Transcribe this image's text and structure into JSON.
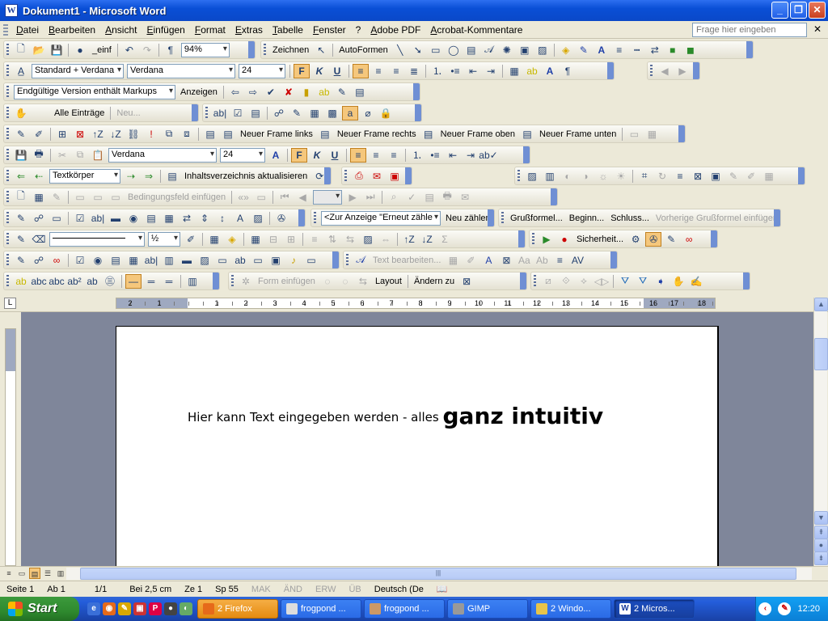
{
  "window": {
    "title": "Dokument1 - Microsoft Word",
    "icon_letter": "W"
  },
  "menu": {
    "items": [
      "Datei",
      "Bearbeiten",
      "Ansicht",
      "Einfügen",
      "Format",
      "Extras",
      "Tabelle",
      "Fenster",
      "?",
      "Adobe PDF",
      "Acrobat-Kommentare"
    ],
    "help_placeholder": "Frage hier eingeben"
  },
  "toolbars": {
    "standard": {
      "insert_label": "_einf",
      "zoom": "94%"
    },
    "drawing": {
      "draw_label": "Zeichnen",
      "autoshapes_label": "AutoFormen"
    },
    "formatting1": {
      "style": "Standard + Verdana",
      "font": "Verdana",
      "size": "24",
      "bold": "F",
      "italic": "K",
      "underline": "U"
    },
    "reviewing": {
      "markup_view": "Endgültige Version enthält Markups",
      "show_label": "Anzeigen"
    },
    "autotext": {
      "all_entries": "Alle Einträge",
      "new_label": "Neu..."
    },
    "frames": {
      "frame_left": "Neuer Frame links",
      "frame_right": "Neuer Frame rechts",
      "frame_top": "Neuer Frame oben",
      "frame_bottom": "Neuer Frame unten"
    },
    "formatting2": {
      "font": "Verdana",
      "size": "24",
      "bold": "F",
      "italic": "K",
      "underline": "U"
    },
    "outline": {
      "level": "Textkörper",
      "toc_update": "Inhaltsverzeichnis aktualisieren"
    },
    "mailmerge": {
      "insert_field": "Bedingungsfeld einfügen"
    },
    "fields": {
      "combo": "<Zur Anzeige \"Erneut zähle",
      "renumber": "Neu zählen"
    },
    "letter": {
      "greeting": "Grußformel...",
      "begin": "Beginn...",
      "closing": "Schluss...",
      "prev_greeting": "Vorherige Grußformel einfügen"
    },
    "tables": {
      "line_weight": "½"
    },
    "security": {
      "label": "Sicherheit..."
    },
    "wordart": {
      "edit_text": "Text bearbeiten..."
    },
    "forms": {
      "insert_form": "Form einfügen",
      "layout": "Layout",
      "change_to": "Ändern zu"
    }
  },
  "ruler": {
    "corner": "L",
    "h_numbers": [
      "2",
      "1",
      "1",
      "2",
      "3",
      "4",
      "5",
      "6",
      "7",
      "8",
      "9",
      "10",
      "11",
      "12",
      "13",
      "14",
      "15",
      "16",
      "17",
      "18"
    ]
  },
  "document": {
    "text_normal": "Hier kann Text eingegeben werden - alles",
    "text_big": "ganz intuitiv"
  },
  "status": {
    "page": "Seite 1",
    "section": "Ab 1",
    "pages": "1/1",
    "position": "Bei 2,5 cm",
    "line": "Ze 1",
    "column": "Sp 55",
    "mak": "MAK",
    "aen": "ÄND",
    "erw": "ERW",
    "ub": "ÜB",
    "language": "Deutsch (De"
  },
  "taskbar": {
    "start": "Start",
    "tasks": [
      "2 Firefox",
      "frogpond ...",
      "frogpond ...",
      "GIMP",
      "2 Windo...",
      "2 Micros..."
    ],
    "clock": "12:20"
  }
}
